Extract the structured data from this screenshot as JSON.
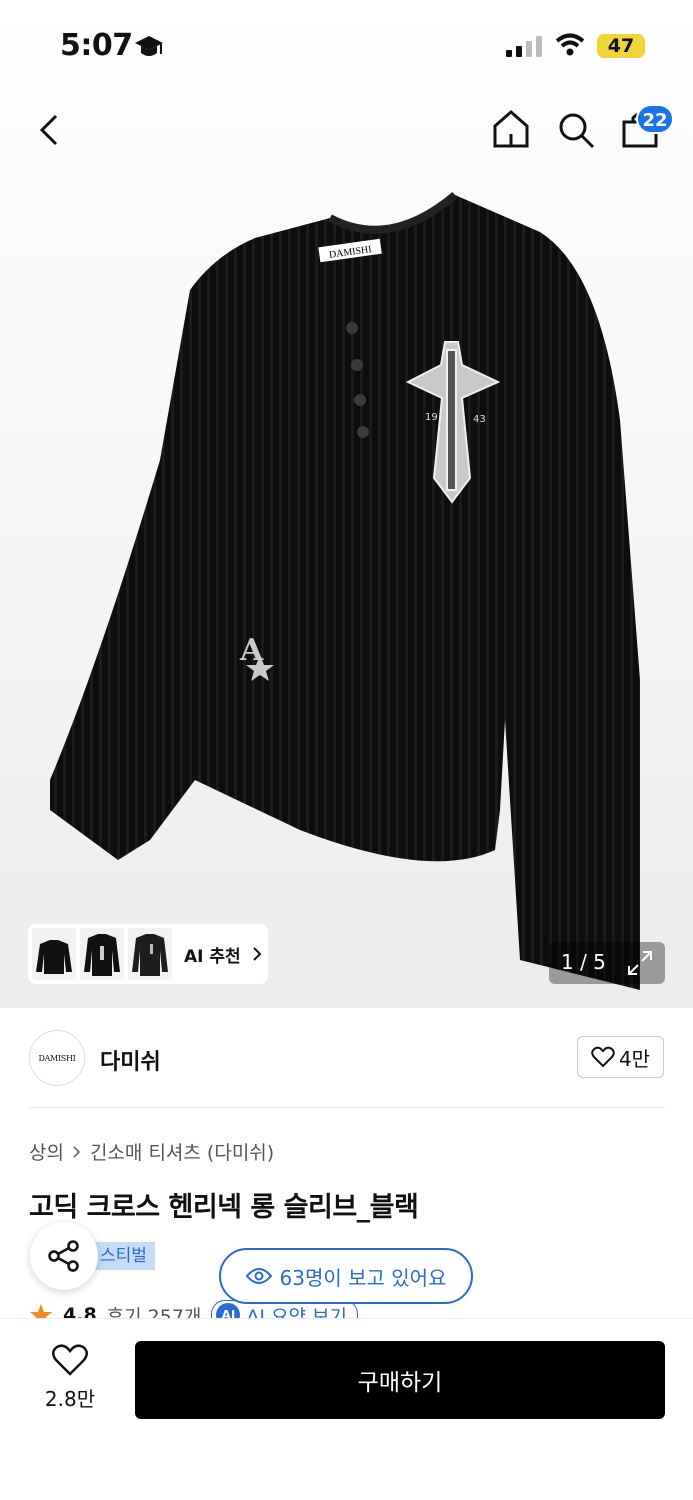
{
  "status_bar": {
    "time": "5:07",
    "battery": "47"
  },
  "nav": {
    "cart_count": "22"
  },
  "hero": {
    "garment_label": "DAMISHI",
    "print_text_left": "19",
    "print_text_right": "43",
    "ai_recommend_label": "AI 추천",
    "pager": "1 / 5"
  },
  "brand": {
    "logo_text": "DAMISHI",
    "name": "다미쉬",
    "likes": "4만"
  },
  "breadcrumb": {
    "category": "상의",
    "subcategory": "긴소매 티셔츠 (다미쉬)"
  },
  "product": {
    "title": "고딕 크로스 헨리넥 롱 슬리브_블랙",
    "tag": "스티벌",
    "viewers": "63명이 보고 있어요",
    "rating": "4.8",
    "reviews": "후기 257개",
    "ai_badge": "AI",
    "ai_summary": "AI 요약 보기"
  },
  "bottom": {
    "wish_count": "2.8만",
    "buy_label": "구매하기"
  },
  "colors": {
    "accent": "#2a6ad3",
    "badge": "#1a73e8",
    "buy_button": "#000000",
    "star": "#f08a24"
  }
}
